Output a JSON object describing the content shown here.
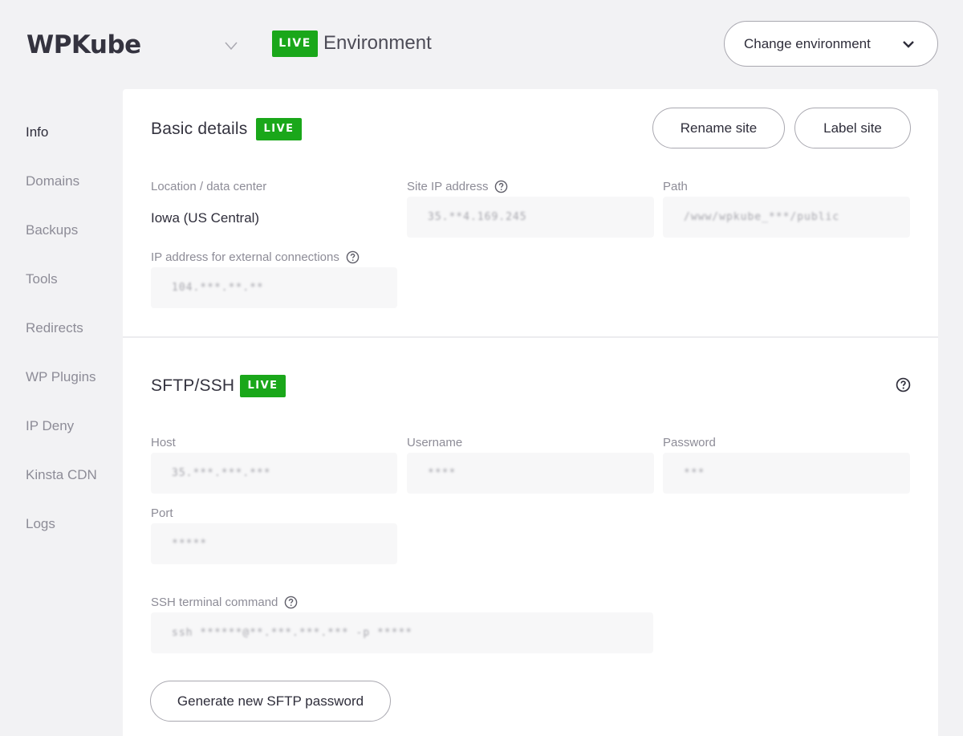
{
  "header": {
    "site_name": "WPKube",
    "env_badge": "LIVE",
    "env_label": "Environment",
    "change_env_label": "Change environment"
  },
  "sidebar": {
    "items": [
      {
        "label": "Info",
        "active": true
      },
      {
        "label": "Domains"
      },
      {
        "label": "Backups"
      },
      {
        "label": "Tools"
      },
      {
        "label": "Redirects"
      },
      {
        "label": "WP Plugins"
      },
      {
        "label": "IP Deny"
      },
      {
        "label": "Kinsta CDN"
      },
      {
        "label": "Logs"
      }
    ]
  },
  "basic_details": {
    "title": "Basic details",
    "badge": "LIVE",
    "rename_label": "Rename site",
    "label_label": "Label site",
    "location_label": "Location / data center",
    "location_value": "Iowa (US Central)",
    "site_ip_label": "Site IP address",
    "path_label": "Path",
    "external_ip_label": "IP address for external connections"
  },
  "sftp": {
    "title": "SFTP/SSH",
    "badge": "LIVE",
    "host_label": "Host",
    "username_label": "Username",
    "password_label": "Password",
    "port_label": "Port",
    "ssh_label": "SSH terminal command",
    "generate_label": "Generate new SFTP password"
  },
  "colors": {
    "live_badge": "#1aa71a",
    "page_background": "#f2f2f4",
    "card_background": "#ffffff"
  }
}
